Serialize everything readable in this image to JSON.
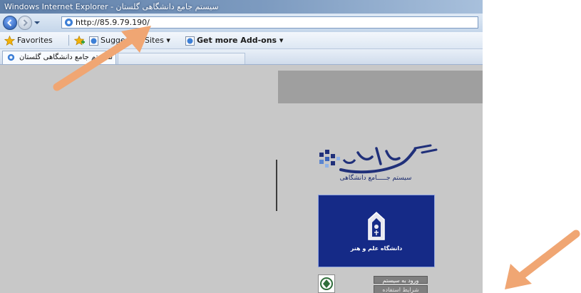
{
  "window": {
    "title": "سیستم جامع دانشگاهی گلستان - Windows Internet Explorer"
  },
  "navigation": {
    "address_url": "http://85.9.79.190/"
  },
  "favorites_bar": {
    "favorites_label": "Favorites",
    "suggested_sites_label": "Suggested Sites ▾",
    "addons_label": "Get more Add-ons ▾"
  },
  "tabs": [
    {
      "label": "سیستم جامع دانشگاهی گلستان"
    }
  ],
  "content": {
    "golestan_subtitle": "سیستم جـــــامع دانشگاهی",
    "university_name": "دانشگاه علم و هنر",
    "login_button": "ورود به سیستم",
    "link_button": "شرایط استفاده"
  },
  "colors": {
    "annotation_arrow": "#f0a673",
    "university_panel": "#152a87",
    "content_background": "#c8c8c8"
  },
  "icons": [
    "ie-icon",
    "back-arrow-icon",
    "forward-arrow-icon",
    "page-icon",
    "favorites-star-icon",
    "add-favorite-icon",
    "ie-page-icon",
    "emblem-icon"
  ]
}
